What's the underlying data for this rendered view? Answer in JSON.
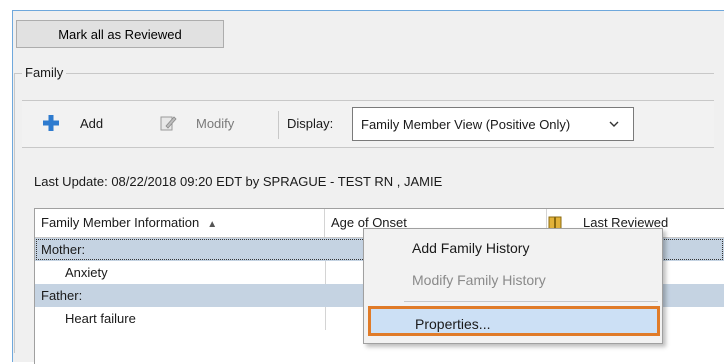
{
  "header": {
    "mark_reviewed_label": "Mark all as Reviewed"
  },
  "family": {
    "group_label": "Family",
    "toolbar": {
      "add_label": "Add",
      "modify_label": "Modify",
      "display_label": "Display:",
      "display_value": "Family Member View (Positive Only)"
    },
    "last_update": "Last Update: 08/22/2018 09:20 EDT by SPRAGUE - TEST RN , JAMIE",
    "table": {
      "columns": [
        "Family Member Information",
        "Age of Onset",
        "Last Reviewed"
      ],
      "rows": [
        {
          "label": "Mother:",
          "kind": "group"
        },
        {
          "label": "Anxiety",
          "kind": "child"
        },
        {
          "label": "Father:",
          "kind": "group"
        },
        {
          "label": "Heart failure",
          "kind": "child"
        }
      ]
    }
  },
  "context_menu": {
    "items": [
      {
        "label": "Add Family History",
        "enabled": true
      },
      {
        "label": "Modify Family History",
        "enabled": false
      },
      {
        "label": "Properties...",
        "enabled": true,
        "highlighted": true
      }
    ]
  },
  "colors": {
    "accent_highlight": "#e07b28",
    "row_highlight": "#c5d3e2",
    "add_icon": "#2e7bcf"
  }
}
